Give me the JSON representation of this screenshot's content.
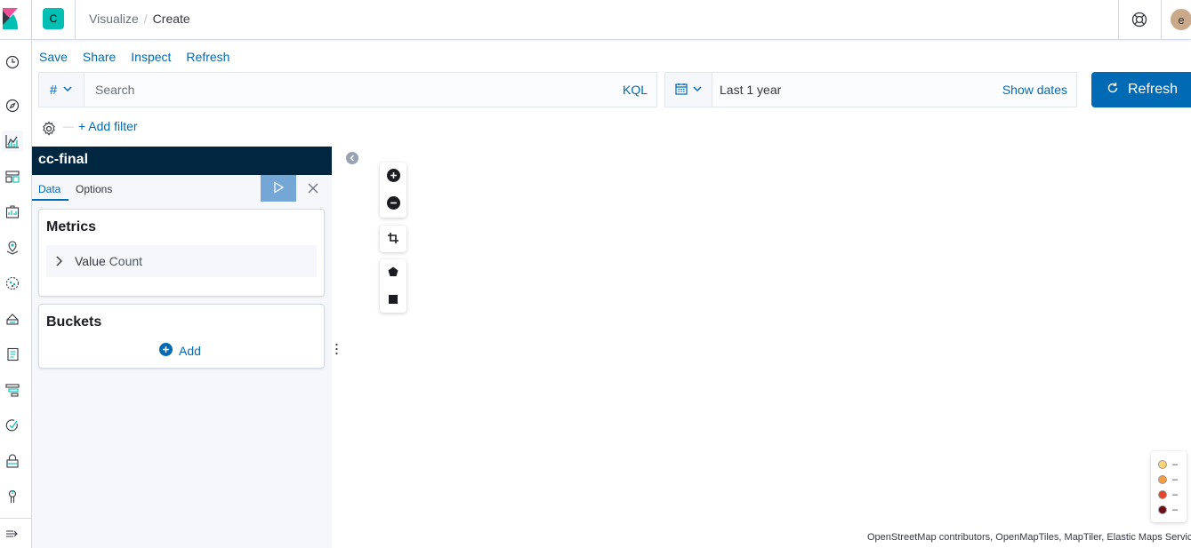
{
  "header": {
    "space_initial": "C",
    "breadcrumbs": [
      "Visualize",
      "Create"
    ],
    "user_initial": "e"
  },
  "top_menu": [
    "Save",
    "Share",
    "Inspect",
    "Refresh"
  ],
  "query_bar": {
    "language_symbol": "#",
    "search_placeholder": "Search",
    "language_label": "KQL"
  },
  "time_picker": {
    "value": "Last 1 year",
    "show_dates_label": "Show dates",
    "refresh_label": "Refresh"
  },
  "filters": {
    "add_filter_label": "+ Add filter",
    "dash": "—"
  },
  "editor": {
    "index_pattern": "cc-final",
    "tabs": [
      "Data",
      "Options"
    ],
    "metrics": {
      "title": "Metrics",
      "item_label": "Value",
      "item_sub": " Count"
    },
    "buckets": {
      "title": "Buckets",
      "add_label": "Add"
    }
  },
  "map": {
    "legend": [
      {
        "color": "#fdd373",
        "label": "–"
      },
      {
        "color": "#f59b40",
        "label": "–"
      },
      {
        "color": "#e9442a",
        "label": "–"
      },
      {
        "color": "#6b0f1a",
        "label": "–"
      }
    ],
    "attribution": "OpenStreetMap contributors, OpenMapTiles, MapTiler, Elastic Maps Service"
  },
  "nav_icons": [
    "kibana-logo-icon",
    "clock-icon",
    "compass-icon",
    "visualize-icon",
    "dashboard-icon",
    "canvas-icon",
    "maps-icon",
    "ml-icon",
    "infrastructure-icon",
    "logs-icon",
    "apm-icon",
    "uptime-icon",
    "security-icon",
    "devtools-icon",
    "dock-icon"
  ]
}
